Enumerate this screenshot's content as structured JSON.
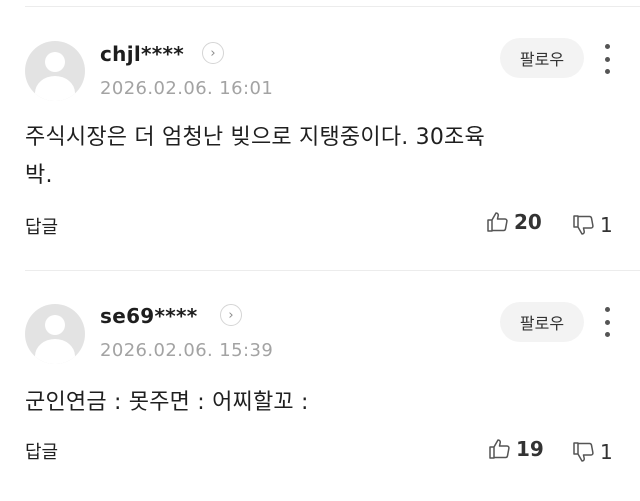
{
  "comments": [
    {
      "username": "chjl****",
      "timestamp": "2026.02.06. 16:01",
      "follow_label": "팔로우",
      "body_line1": "주식시장은 더 엄청난 빚으로 지탱중이다. 30조육",
      "body_line2": "박.",
      "reply_label": "답글",
      "likes": "20",
      "dislikes": "1"
    },
    {
      "username": "se69****",
      "timestamp": "2026.02.06. 15:39",
      "follow_label": "팔로우",
      "body_line1": "군인연금 : 못주면 :  어찌할꼬 :",
      "body_line2": "",
      "reply_label": "답글",
      "likes": "19",
      "dislikes": "1"
    }
  ],
  "icons": {
    "profile_link": "chevron-right-icon",
    "more": "more-vertical-icon",
    "like": "thumbs-up-icon",
    "dislike": "thumbs-down-icon"
  }
}
